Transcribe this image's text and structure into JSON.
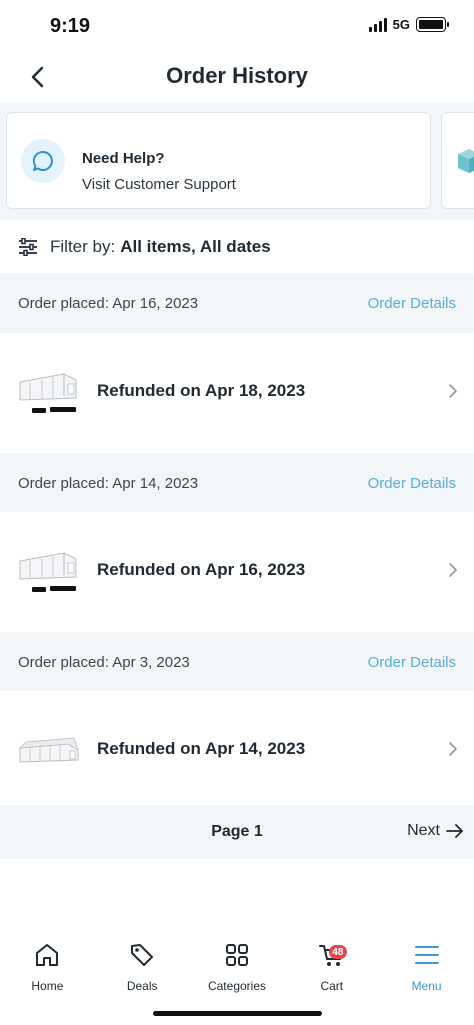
{
  "status_bar": {
    "time": "9:19",
    "network": "5G",
    "signal_bars": 4
  },
  "header": {
    "title": "Order History",
    "back_icon": "chevron-left-icon"
  },
  "help": {
    "title": "Need Help?",
    "subtitle": "Visit Customer Support",
    "icon": "chat-bubble-icon",
    "second_card_icon": "box-icon"
  },
  "filter": {
    "label": "Filter by:",
    "value": "All items, All dates",
    "icon": "sliders-icon"
  },
  "orders": [
    {
      "placed": "Order placed: Apr 16, 2023",
      "details_link": "Order Details",
      "status": "Refunded on Apr 18, 2023",
      "thumb": "tent-with-pads"
    },
    {
      "placed": "Order placed: Apr 14, 2023",
      "details_link": "Order Details",
      "status": "Refunded on Apr 16, 2023",
      "thumb": "tent-with-pads"
    },
    {
      "placed": "Order placed: Apr 3, 2023",
      "details_link": "Order Details",
      "status": "Refunded on Apr 14, 2023",
      "thumb": "tent"
    }
  ],
  "pagination": {
    "page_label": "Page 1",
    "next_label": "Next"
  },
  "bottom_nav": {
    "items": [
      {
        "label": "Home",
        "icon": "home-icon"
      },
      {
        "label": "Deals",
        "icon": "tag-icon"
      },
      {
        "label": "Categories",
        "icon": "grid-icon"
      },
      {
        "label": "Cart",
        "icon": "cart-icon",
        "badge": "48"
      },
      {
        "label": "Menu",
        "icon": "menu-icon",
        "active": true
      }
    ]
  },
  "colors": {
    "accent": "#5aaed6",
    "active_nav": "#3d9ad1",
    "badge": "#e2474f",
    "section_bg": "#f2f6f8"
  }
}
